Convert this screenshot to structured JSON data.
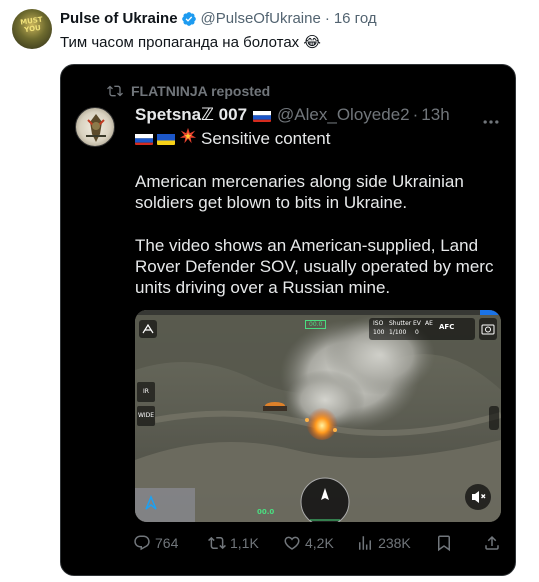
{
  "outer": {
    "name": "Pulse of Ukraine",
    "handle": "@PulseOfUkraine",
    "separator": "·",
    "time": "16 год",
    "text": "Тим часом пропаганда на болотах 😂",
    "avatar_text": "MUST YOU"
  },
  "quoted": {
    "repost_label": "FLATNINJA reposted",
    "name": "Spetsnaℤ 007",
    "handle": "@Alex_Oloyede2",
    "separator": "·",
    "time": "13h",
    "sensitive_label": "Sensitive content",
    "paragraph1": "American mercenaries along side Ukrainian soldiers get blown to bits in Ukraine.",
    "paragraph2": "The video shows an American-supplied, Land Rover Defender SOV, usually operated by merc units driving over a Russian mine.",
    "media_hud": {
      "iso": "ISO",
      "shutter": "Shutter",
      "ev": "EV",
      "ae": "AE",
      "iso_val": "100",
      "shutter_val": "1/100",
      "ev_val": "0",
      "afc": "AFC",
      "ir": "IR",
      "wide": "WIDE",
      "green_readout": "00.0",
      "green_readout2": "00.0"
    },
    "actions": {
      "replies": "764",
      "reposts": "1,1K",
      "likes": "4,2K",
      "views": "238K"
    }
  },
  "colors": {
    "verified": "#1d9bf0",
    "card_bg": "#000000",
    "muted_text": "#71767b"
  }
}
